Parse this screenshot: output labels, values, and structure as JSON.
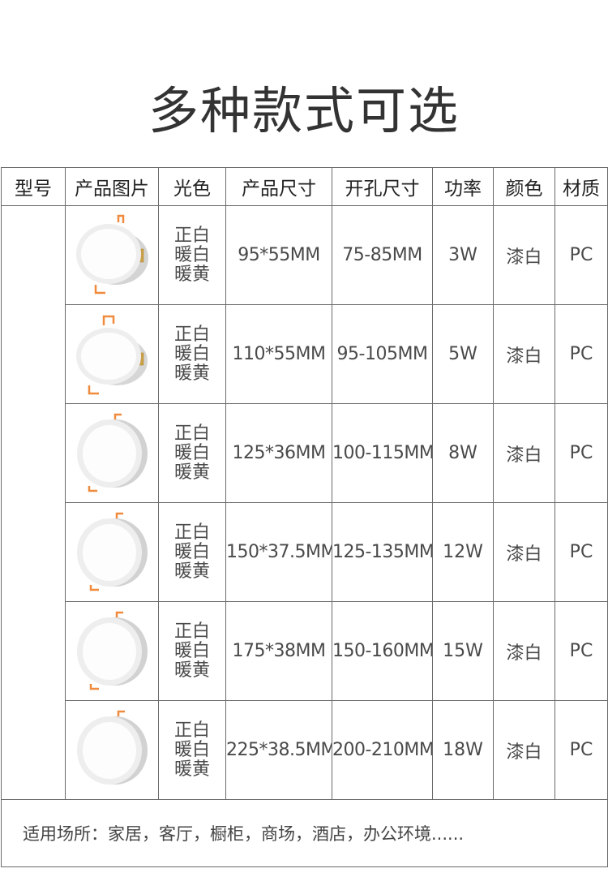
{
  "title": "多种款式可选",
  "headers": [
    "型号",
    "产品图片",
    "光色",
    "产品尺寸",
    "开孔尺寸",
    "功率",
    "颜色",
    "材质"
  ],
  "rows": [
    {
      "light": [
        "正白",
        "暖白",
        "暖黄"
      ],
      "size": "95*55MM",
      "hole": "75-85MM",
      "power": "3W",
      "color": "漆白",
      "material": "PC"
    },
    {
      "light": [
        "正白",
        "暖白",
        "暖黄"
      ],
      "size": "110*55MM",
      "hole": "95-105MM",
      "power": "5W",
      "color": "漆白",
      "material": "PC"
    },
    {
      "light": [
        "正白",
        "暖白",
        "暖黄"
      ],
      "size": "125*36MM",
      "hole": "100-115MM",
      "power": "8W",
      "color": "漆白",
      "material": "PC"
    },
    {
      "light": [
        "正白",
        "暖白",
        "暖黄"
      ],
      "size": "150*37.5MM",
      "hole": "125-135MM",
      "power": "12W",
      "color": "漆白",
      "material": "PC"
    },
    {
      "light": [
        "正白",
        "暖白",
        "暖黄"
      ],
      "size": "175*38MM",
      "hole": "150-160MM",
      "power": "15W",
      "color": "漆白",
      "material": "PC"
    },
    {
      "light": [
        "正白",
        "暖白",
        "暖黄"
      ],
      "size": "225*38.5MM",
      "hole": "200-210MM",
      "power": "18W",
      "color": "漆白",
      "material": "PC"
    }
  ],
  "footer": "适用场所：家居，客厅，橱柜，商场，酒店，办公环境......"
}
